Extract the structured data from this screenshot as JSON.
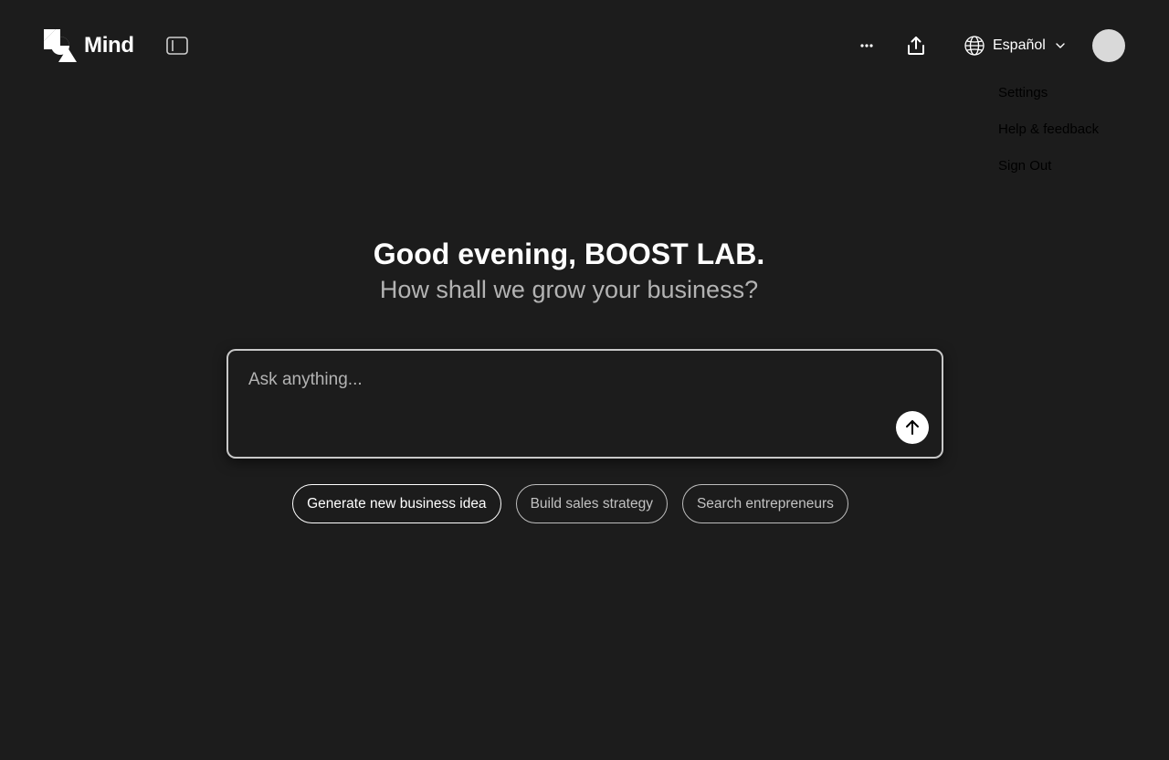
{
  "brand": {
    "name": "Mind",
    "logo_icon": "mind-logo-icon"
  },
  "header": {
    "sidebar_toggle_icon": "sidebar-panel-icon",
    "more_icon": "more-horizontal-icon",
    "share_icon": "share-upload-icon",
    "language": {
      "label": "Español",
      "icon": "globe-icon",
      "chevron": "chevron-down-icon"
    },
    "avatar_color": "#d9d9d9"
  },
  "account_menu": {
    "items": [
      {
        "label": "Settings"
      },
      {
        "label": "Help & feedback"
      },
      {
        "label": "Sign Out"
      }
    ]
  },
  "greeting": {
    "title": "Good evening, BOOST LAB.",
    "subtitle": "How shall we grow your business?"
  },
  "prompt": {
    "placeholder": "Ask anything...",
    "value": "",
    "send_icon": "arrow-up-icon"
  },
  "suggestions": [
    {
      "label": "Generate new business idea"
    },
    {
      "label": "Build sales strategy"
    },
    {
      "label": "Search entrepreneurs"
    }
  ],
  "colors": {
    "background": "#1c1c1c",
    "text_primary": "#ffffff",
    "text_secondary": "#b3b3b3",
    "border": "#c8c8c8"
  }
}
